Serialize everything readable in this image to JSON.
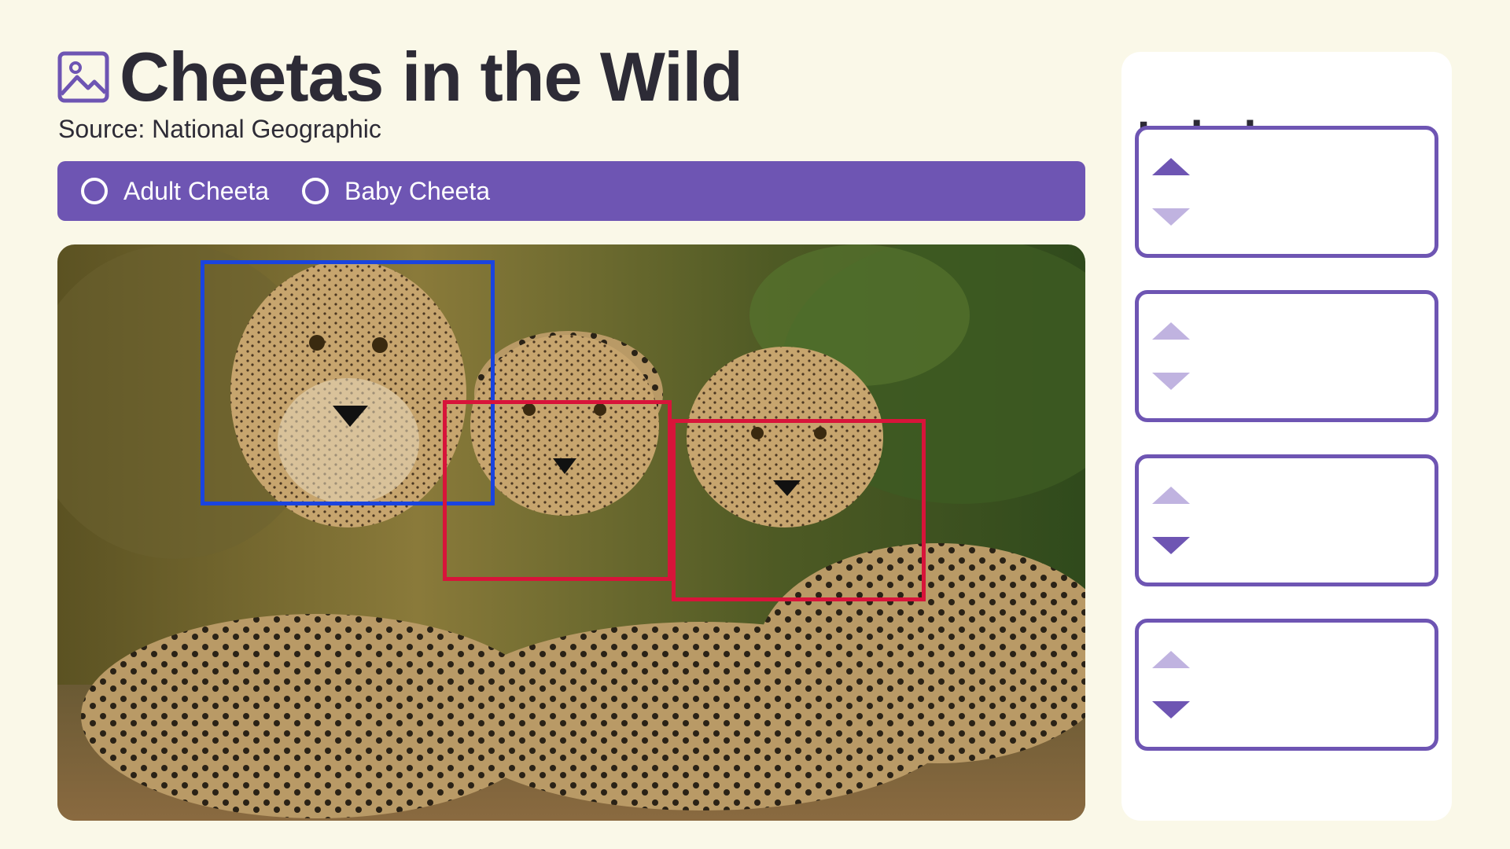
{
  "app": {
    "title": "Cheetas in the Wild",
    "source": "Source: National Geographic",
    "title_icon": "image-icon"
  },
  "classes": [
    {
      "label": "Adult Cheeta",
      "color": "#1a44e0",
      "selected": false
    },
    {
      "label": "Baby Cheeta",
      "color": "#d8143a",
      "selected": false
    }
  ],
  "annotations": [
    {
      "class": "Adult Cheeta"
    },
    {
      "class": "Baby Cheeta"
    },
    {
      "class": "Baby Cheeta"
    }
  ],
  "labels_panel": {
    "title": "Labels",
    "cards": [
      {
        "up": "active",
        "down": "inactive"
      },
      {
        "up": "inactive",
        "down": "inactive"
      },
      {
        "up": "inactive",
        "down": "active"
      },
      {
        "up": "inactive",
        "down": "active"
      }
    ]
  },
  "colors": {
    "background": "#faf8e8",
    "accent": "#6e55b3",
    "accent_light": "#c0b3e0",
    "text": "#2d2b36"
  }
}
